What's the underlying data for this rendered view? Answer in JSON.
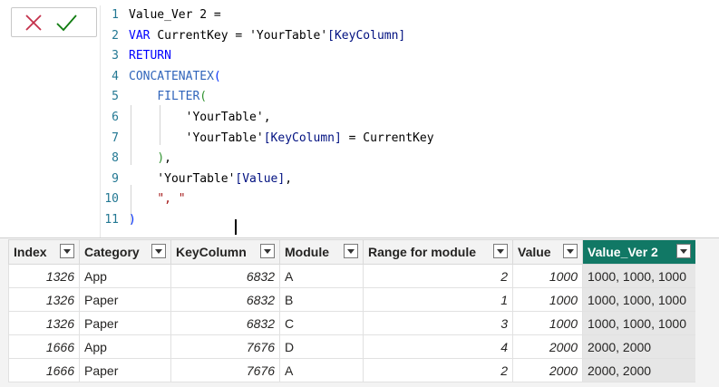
{
  "formula_bar": {
    "cancel_label": "✕",
    "commit_label": "✓",
    "lines": [
      {
        "num": "1",
        "tokens": [
          {
            "t": "Value_Ver 2 =",
            "c": "plain"
          }
        ]
      },
      {
        "num": "2",
        "tokens": [
          {
            "t": "VAR ",
            "c": "kw"
          },
          {
            "t": "CurrentKey = ",
            "c": "plain"
          },
          {
            "t": "'YourTable'",
            "c": "plain"
          },
          {
            "t": "[KeyColumn]",
            "c": "col"
          }
        ]
      },
      {
        "num": "3",
        "tokens": [
          {
            "t": "RETURN",
            "c": "kw"
          }
        ]
      },
      {
        "num": "4",
        "tokens": [
          {
            "t": "CONCATENATEX",
            "c": "fn"
          },
          {
            "t": "(",
            "c": "br1"
          }
        ]
      },
      {
        "num": "5",
        "tokens": [
          {
            "t": "    ",
            "c": "plain"
          },
          {
            "t": "FILTER",
            "c": "fn"
          },
          {
            "t": "(",
            "c": "br2"
          }
        ]
      },
      {
        "num": "6",
        "tokens": [
          {
            "t": "        'YourTable',",
            "c": "plain"
          }
        ]
      },
      {
        "num": "7",
        "tokens": [
          {
            "t": "        'YourTable'",
            "c": "plain"
          },
          {
            "t": "[KeyColumn]",
            "c": "col"
          },
          {
            "t": " = CurrentKey",
            "c": "plain"
          }
        ]
      },
      {
        "num": "8",
        "tokens": [
          {
            "t": "    ",
            "c": "plain"
          },
          {
            "t": ")",
            "c": "br2"
          },
          {
            "t": ",",
            "c": "plain"
          }
        ]
      },
      {
        "num": "9",
        "tokens": [
          {
            "t": "    'YourTable'",
            "c": "plain"
          },
          {
            "t": "[Value]",
            "c": "col"
          },
          {
            "t": ",",
            "c": "plain"
          }
        ]
      },
      {
        "num": "10",
        "tokens": [
          {
            "t": "    ",
            "c": "plain"
          },
          {
            "t": "\", \"",
            "c": "str"
          }
        ]
      },
      {
        "num": "11",
        "tokens": [
          {
            "t": ")",
            "c": "br1"
          }
        ]
      }
    ]
  },
  "table": {
    "columns": [
      {
        "label": "Index",
        "align": "num"
      },
      {
        "label": "Category",
        "align": "text"
      },
      {
        "label": "KeyColumn",
        "align": "num"
      },
      {
        "label": "Module",
        "align": "text"
      },
      {
        "label": "Range for module",
        "align": "num"
      },
      {
        "label": "Value",
        "align": "num"
      },
      {
        "label": "Value_Ver 2",
        "align": "text",
        "selected": true
      }
    ],
    "rows": [
      [
        "1326",
        "App",
        "6832",
        "A",
        "2",
        "1000",
        "1000, 1000, 1000"
      ],
      [
        "1326",
        "Paper",
        "6832",
        "B",
        "1",
        "1000",
        "1000, 1000, 1000"
      ],
      [
        "1326",
        "Paper",
        "6832",
        "C",
        "3",
        "1000",
        "1000, 1000, 1000"
      ],
      [
        "1666",
        "App",
        "7676",
        "D",
        "4",
        "2000",
        "2000, 2000"
      ],
      [
        "1666",
        "Paper",
        "7676",
        "A",
        "2",
        "2000",
        "2000, 2000"
      ]
    ]
  },
  "colors": {
    "selected_header": "#117865",
    "selected_column_bg": "#e6e6e6",
    "cancel_icon": "#c4314b",
    "commit_icon": "#107c10"
  }
}
